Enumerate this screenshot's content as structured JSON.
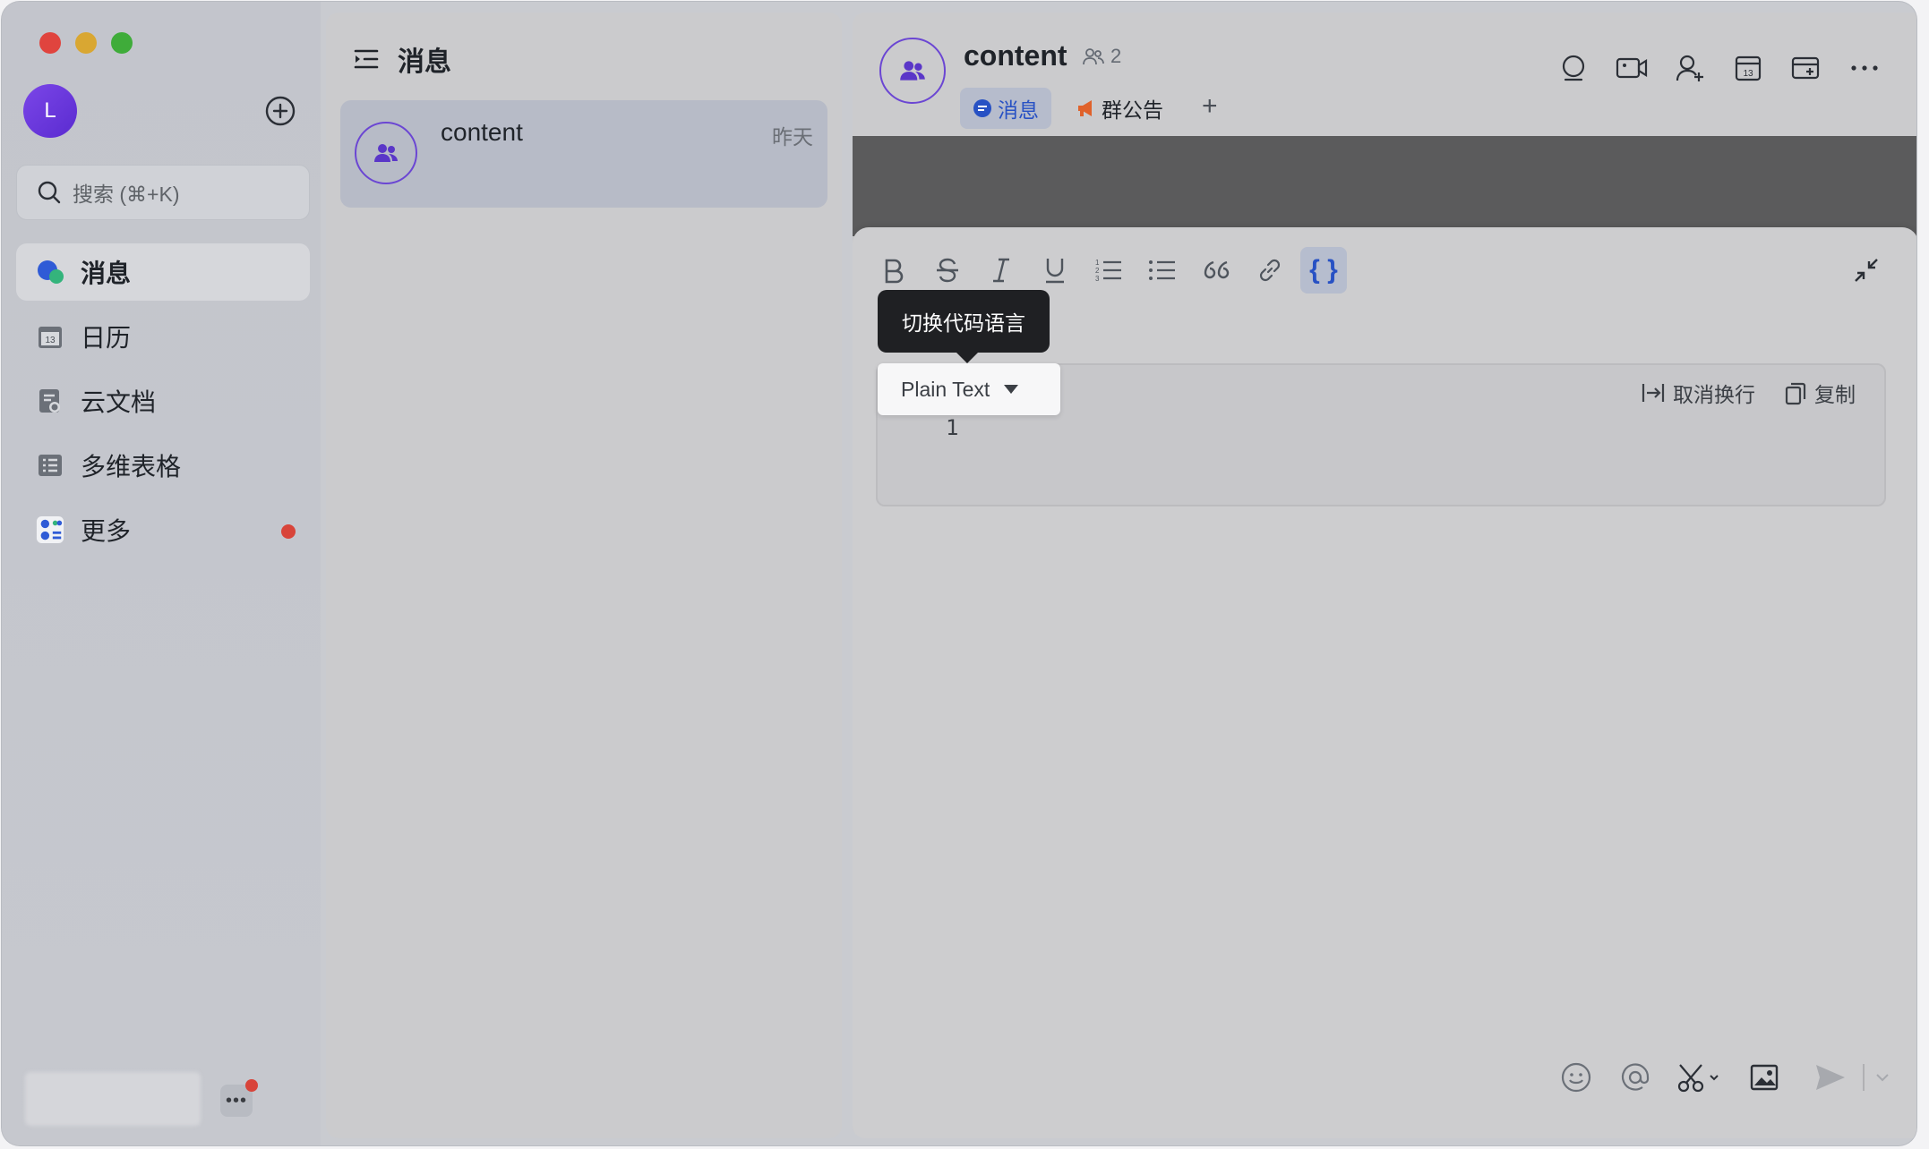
{
  "user": {
    "avatar_letter": "L"
  },
  "search": {
    "placeholder": "搜索 (⌘+K)"
  },
  "sidebar": {
    "items": [
      {
        "label": "消息",
        "icon": "chat-bubble-icon",
        "active": true
      },
      {
        "label": "日历",
        "icon": "calendar-icon",
        "badge": "13"
      },
      {
        "label": "云文档",
        "icon": "cloud-doc-icon"
      },
      {
        "label": "多维表格",
        "icon": "base-table-icon"
      },
      {
        "label": "更多",
        "icon": "apps-grid-icon",
        "has_dot": true
      }
    ]
  },
  "message_list": {
    "title": "消息",
    "conversations": [
      {
        "name": "content",
        "time": "昨天",
        "icon": "group-icon"
      }
    ]
  },
  "chat": {
    "title": "content",
    "member_count": "2",
    "tabs": [
      {
        "label": "消息",
        "icon": "chat-bubble-icon",
        "active": true
      },
      {
        "label": "群公告",
        "icon": "megaphone-icon"
      }
    ],
    "header_icons": [
      "search-icon",
      "video-call-icon",
      "add-member-icon",
      "calendar-icon",
      "new-tab-icon",
      "more-icon"
    ],
    "calendar_badge": "13"
  },
  "editor": {
    "toolbar": [
      "bold-icon",
      "strikethrough-icon",
      "italic-icon",
      "underline-icon",
      "ordered-list-icon",
      "bullet-list-icon",
      "quote-icon",
      "link-icon",
      "code-block-icon"
    ],
    "tooltip": "切换代码语言",
    "code_language": "Plain Text",
    "line_number": "1",
    "unwrap_label": "取消换行",
    "copy_label": "复制"
  },
  "composer": {
    "icons": [
      "emoji-icon",
      "mention-icon",
      "screenshot-icon",
      "image-icon",
      "send-icon",
      "send-options-icon"
    ]
  },
  "colors": {
    "accent": "#2751c4",
    "brand_purple": "#6b46d3",
    "badge_red": "#d8443a"
  }
}
